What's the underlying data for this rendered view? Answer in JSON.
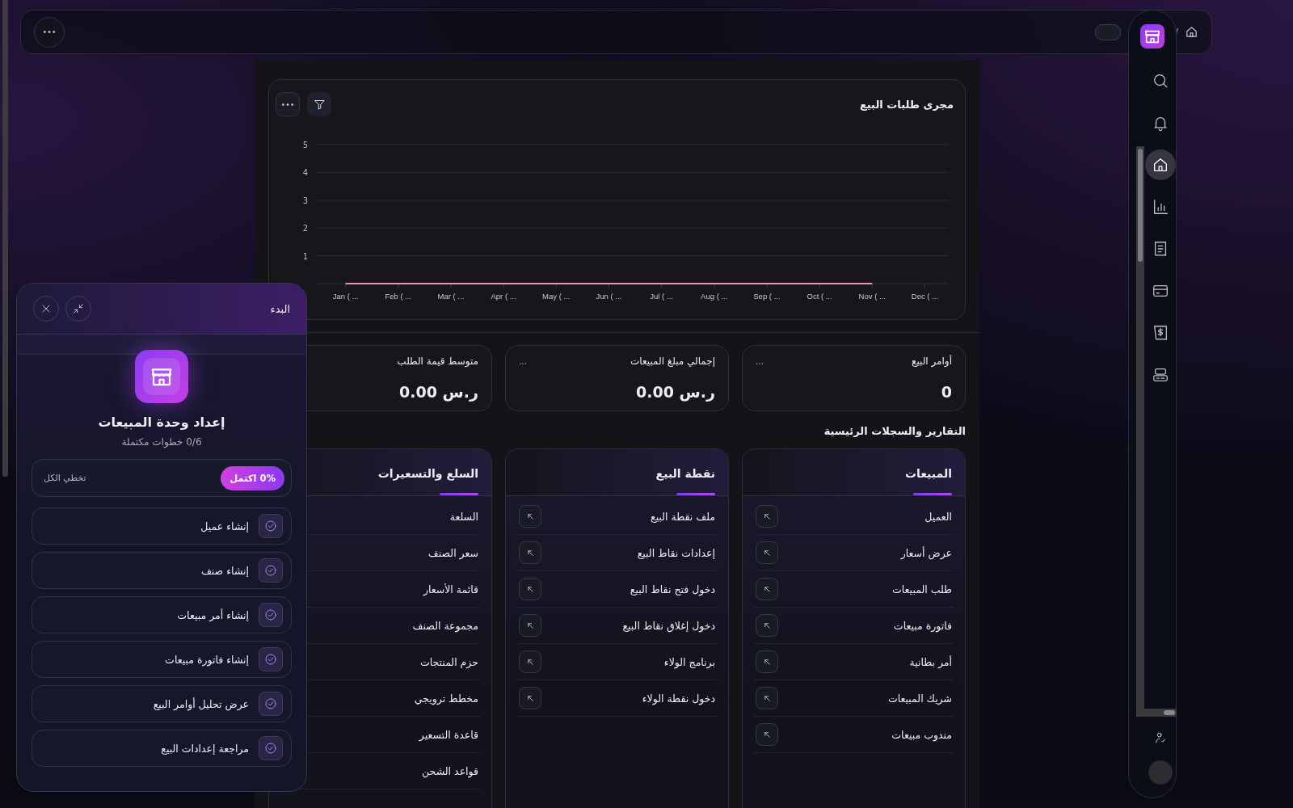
{
  "top_bar": {
    "toggle_on": false,
    "breadcrumb_separator": "/"
  },
  "sidebar": {
    "nav_items": [
      {
        "selected": false
      },
      {
        "selected": false
      },
      {
        "selected": true
      },
      {
        "selected": false
      },
      {
        "selected": false
      },
      {
        "selected": false
      },
      {
        "selected": false
      },
      {
        "selected": false
      }
    ]
  },
  "chart_card": {
    "chart_data": {
      "type": "line",
      "title": "مجرى طلبات البيع",
      "categories": [
        "Jan ( ...",
        "Feb ( ...",
        "Mar ( ...",
        "Apr ( ...",
        "May ( ...",
        "Jun ( ...",
        "Jul ( ...",
        "Aug ( ...",
        "Sep ( ...",
        "Oct ( ...",
        "Nov ( ...",
        "Dec ( ..."
      ],
      "series": [
        {
          "color": "#f28db5",
          "values": [
            0,
            0,
            0,
            0,
            0,
            0,
            0,
            0,
            0,
            0,
            0,
            null
          ]
        }
      ],
      "ylim": [
        0,
        5
      ],
      "yticks": [
        1,
        2,
        3,
        4,
        5
      ],
      "grid": true
    }
  },
  "stats": [
    {
      "label": "أوامر البيع",
      "value": "0",
      "menu": "..."
    },
    {
      "label": "إجمالي مبلغ المبيعات",
      "value": "ر.س 0.00",
      "menu": "..."
    },
    {
      "label": "متوسط قيمة الطلب",
      "value": "ر.س 0.00"
    }
  ],
  "section_title": "التقارير والسجلات الرئيسية",
  "modules": [
    {
      "title": "المبيعات",
      "shortcut_buttons": true,
      "links": [
        "العميل",
        "عرض أسعار",
        "طلب المبيعات",
        "فاتورة مبيعات",
        "أمر بطانية",
        "شريك المبيعات",
        "مندوب مبيعات"
      ]
    },
    {
      "title": "نقطة البيع",
      "shortcut_buttons": true,
      "links": [
        "ملف نقطة البيع",
        "إعدادات نقاط البيع",
        "دخول فتح نقاط البيع",
        "دخول إغلاق نقاط البيع",
        "برنامج الولاء",
        "دخول نقطة الولاء"
      ]
    },
    {
      "title": "السلع والتسعيرات",
      "links": [
        "السلعة",
        "سعر الصنف",
        "قائمة الأسعار",
        "مجموعة الصنف",
        "حزم المنتجات",
        "مخطط ترويجي",
        "قاعدة التسعير",
        "قواعد الشحن"
      ]
    }
  ],
  "onboarding": {
    "title": "البدء",
    "heading": "إعداد وحدة المبيعات",
    "progress_text": "0/6 خطوات مكتملة",
    "progress_badge": "0% اكتمل",
    "skip": "تخطي الكل",
    "steps": [
      {
        "label": "إنشاء عميل"
      },
      {
        "label": "إنشاء صنف"
      },
      {
        "label": "إنشاء أمر مبيعات"
      },
      {
        "label": "إنشاء فاتورة مبيعات"
      },
      {
        "label": "عرض تحليل أوامر البيع"
      },
      {
        "label": "مراجعة إعدادات البيع"
      }
    ]
  }
}
